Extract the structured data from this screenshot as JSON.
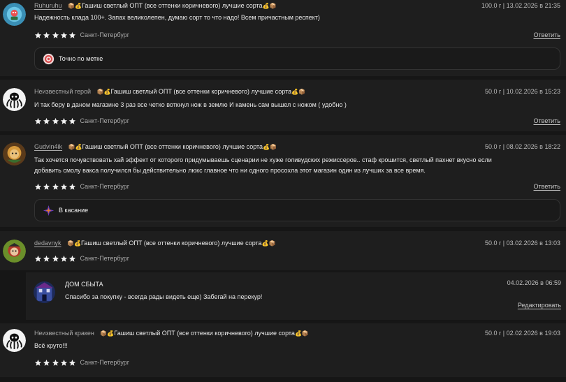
{
  "product_title": "Гашиш светлый ОПТ (все оттенки коричневого) лучшие сорта",
  "reply_label": "Ответить",
  "reviews": [
    {
      "author": "Ruhuruhu",
      "meta": "100.0 г | 13.02.2026 в 21:35",
      "text": "Надежность клада 100+. Запах великолепен, думаю сорт то что надо! Всем причастным респект)",
      "city": "Санкт-Петербург",
      "rating": 5,
      "tag": "Точно по метке"
    },
    {
      "author": "Неизвестный герой",
      "meta": "50.0 г | 10.02.2026 в 15:23",
      "text": "И так беру в даном магазине 3 раз все четко воткнул нож в землю И камень сам вышел с ножом ( удобно )",
      "city": "Санкт-Петербург",
      "rating": 5
    },
    {
      "author": "Gudvin4ik",
      "meta": "50.0 г | 08.02.2026 в 18:22",
      "text_line1": "Так хочется почувствовать хай эффект от которого придумываешь сценарии не хуже голивудских режиссеров.. стаф крошится, светлый пахнет вкусно если",
      "text_line2": "добавить смолу вакса получился бы действительно люкс главное что ни одного просохла этот магазин один из лучших за все время.",
      "city": "Санкт-Петербург",
      "rating": 5,
      "tag": "В касание"
    },
    {
      "author": "dedavnyk",
      "meta": "50.0 г | 03.02.2026 в 13:03",
      "city": "Санкт-Петербург",
      "rating": 5,
      "seller_reply": {
        "name": "ДОМ СБЫТА",
        "date": "04.02.2026 в 06:59",
        "text": "Спасибо за покупку - всегда рады видеть еще) Забегай на перекур!",
        "edit_label": "Редактировать"
      }
    },
    {
      "author": "Неизвестный кракен",
      "meta": "50.0 г | 02.02.2026 в 19:03",
      "text": "Всё круто!!!",
      "city": "Санкт-Петербург",
      "rating": 5
    }
  ]
}
